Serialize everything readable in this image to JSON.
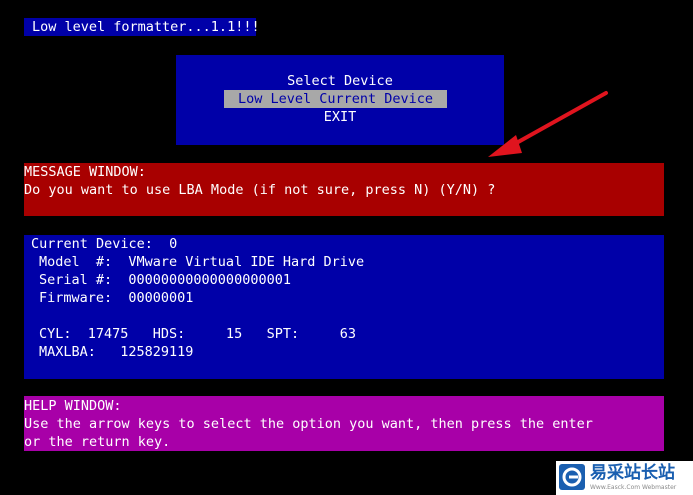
{
  "title_bar": {
    "text": "Low level formatter...1.1!!!"
  },
  "menu": {
    "items": [
      {
        "label": "Select Device",
        "selected": false
      },
      {
        "label": "Low Level Current Device",
        "selected": true
      },
      {
        "label": "EXIT",
        "selected": false
      }
    ]
  },
  "message_window": {
    "header": "MESSAGE WINDOW:",
    "text": "Do you want to use LBA Mode (if not sure, press N) (Y/N) ?"
  },
  "device_window": {
    "current_device_line": "Current Device:  0",
    "model_line": "Model  #:  VMware Virtual IDE Hard Drive",
    "serial_line": "Serial #:  00000000000000000001",
    "firmware_line": "Firmware:  00000001",
    "geometry_line": "CYL:  17475   HDS:     15   SPT:     63",
    "maxlba_line": "MAXLBA:   125829119"
  },
  "help_window": {
    "header": "HELP WINDOW:",
    "line1": "Use the arrow keys to select the option you want, then press the enter",
    "line2": "or the return key."
  },
  "watermark": {
    "text": "易采站长站",
    "url": "Www.Easck.Com  Webmaster"
  },
  "colors": {
    "background": "#000000",
    "blue": "#0000a8",
    "red": "#a80000",
    "magenta": "#a800a8",
    "highlight": "#a8a8a8",
    "arrow": "#e0141e"
  }
}
